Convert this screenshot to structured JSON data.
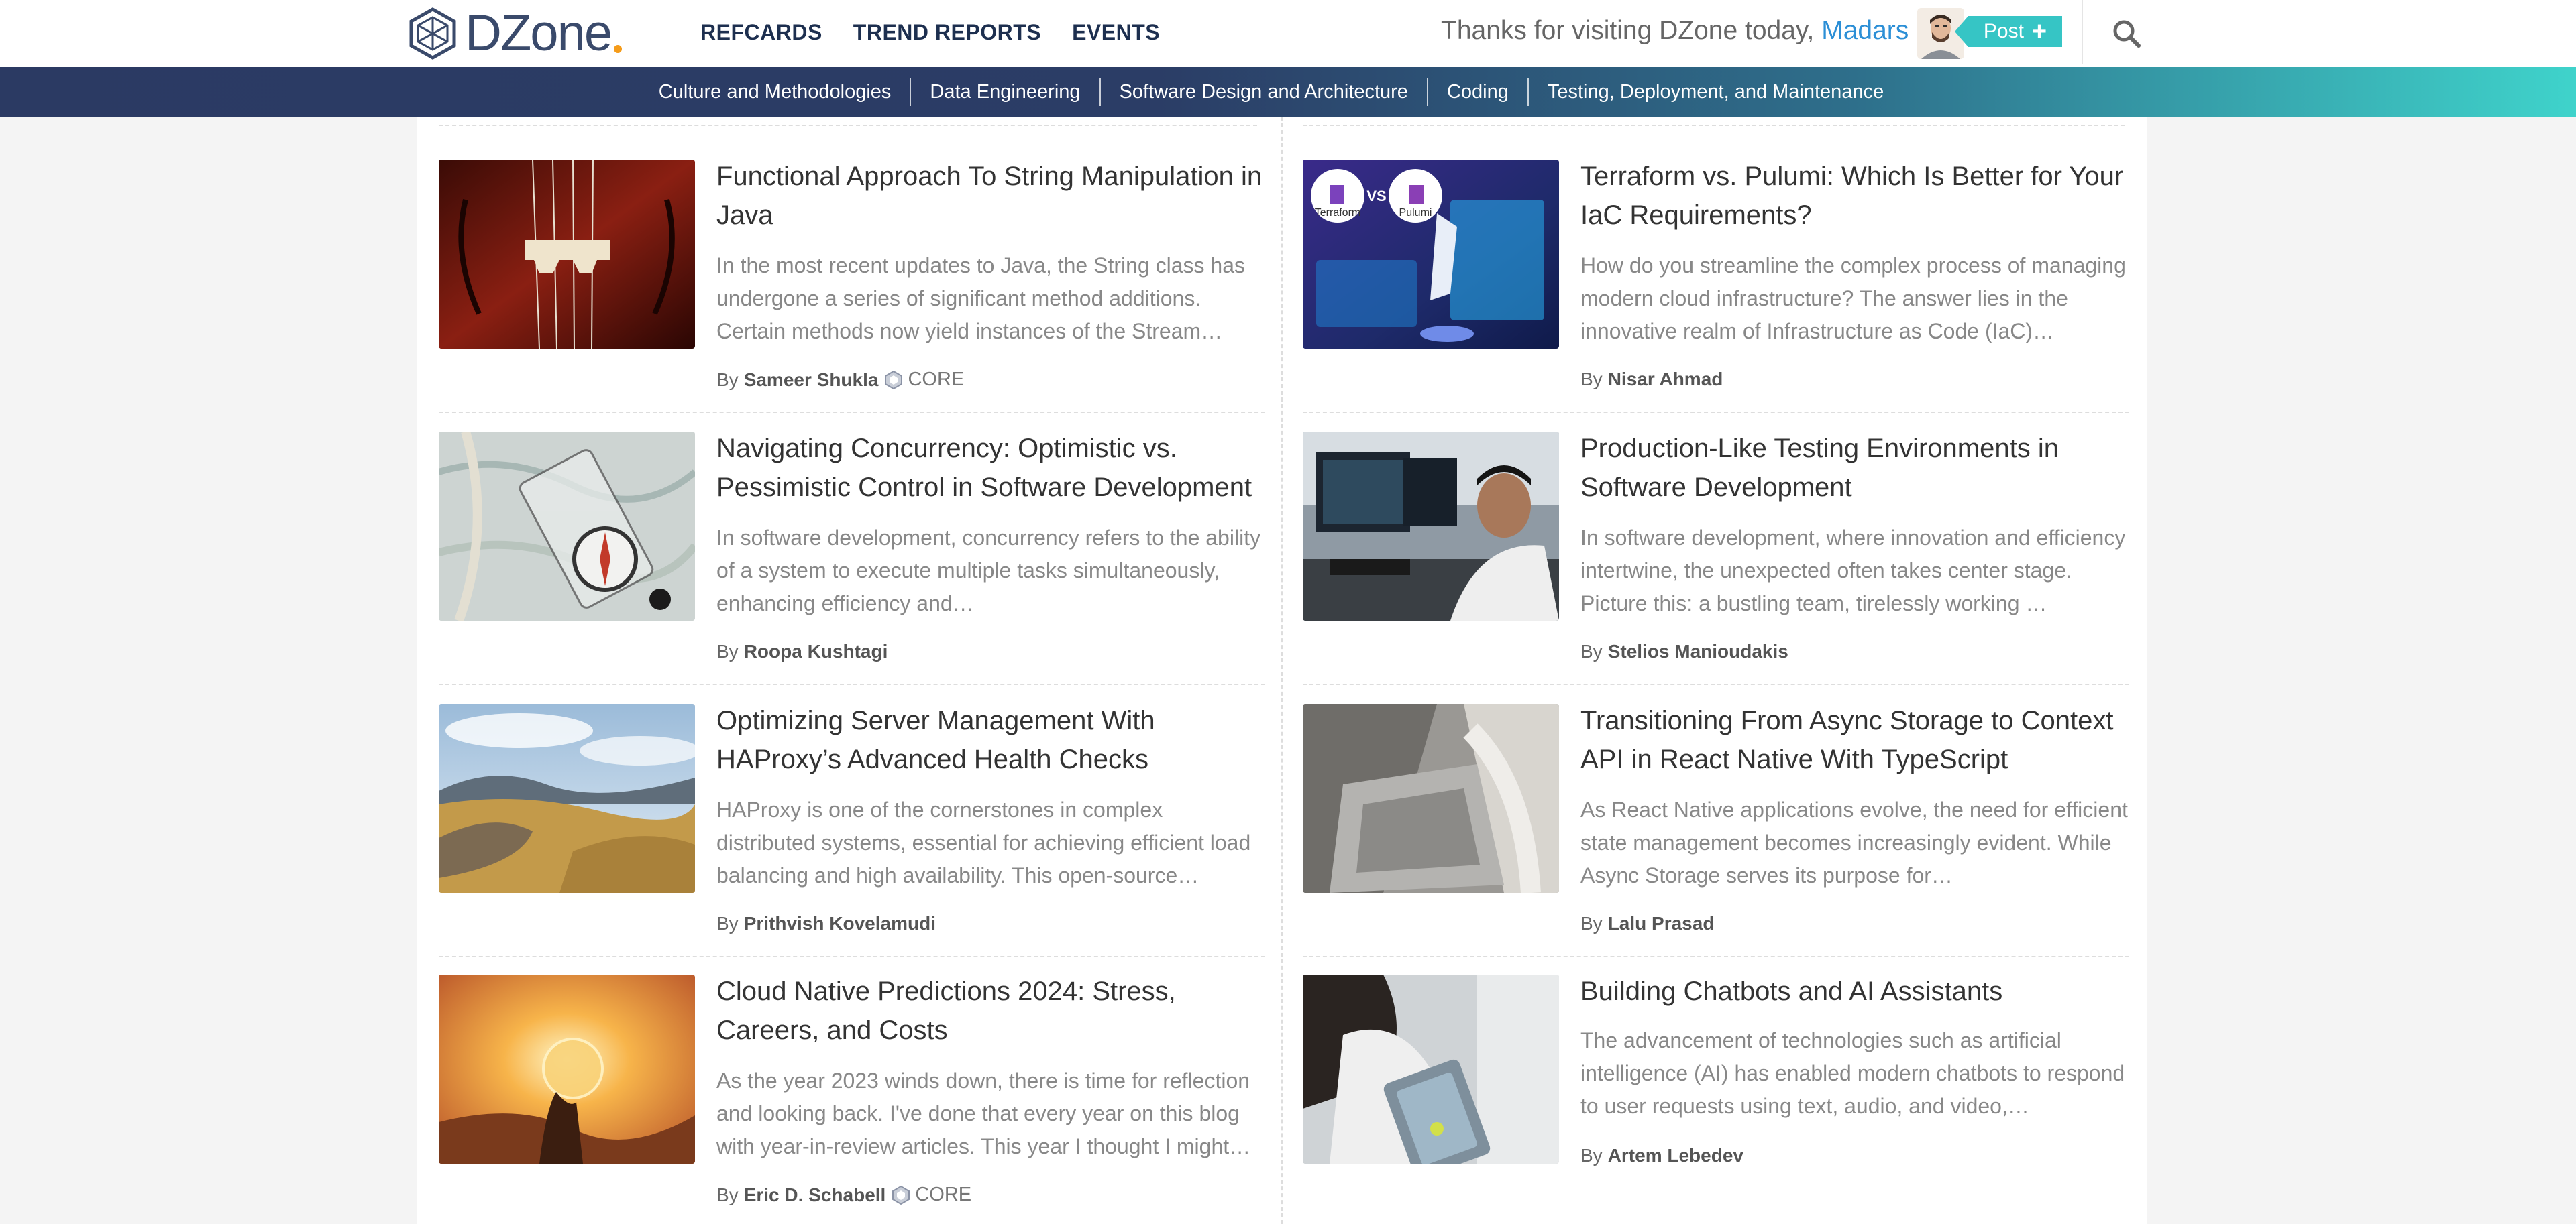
{
  "header": {
    "logo_text": "DZone",
    "nav": [
      "REFCARDS",
      "TREND REPORTS",
      "EVENTS"
    ],
    "greeting_prefix": "Thanks for visiting DZone today,",
    "username": "Madars",
    "post_label": "Post",
    "post_icon": "+",
    "search_icon": "search-icon"
  },
  "categories": [
    "Culture and Methodologies",
    "Data Engineering",
    "Software Design and Architecture",
    "Coding",
    "Testing, Deployment, and Maintenance"
  ],
  "articles": [
    {
      "title": "Functional Approach To String Manipulation in Java",
      "description": "In the most recent updates to Java, the String class has undergone a series of significant method additions. Certain methods now yield instances of the Stream…",
      "by": "By",
      "author": "Sameer Shukla",
      "badge": "CORE"
    },
    {
      "title": "Terraform vs. Pulumi: Which Is Better for Your IaC Requirements?",
      "description": "How do you streamline the complex process of managing modern cloud infrastructure? The answer lies in the innovative realm of Infrastructure as Code (IaC)…",
      "by": "By",
      "author": "Nisar Ahmad",
      "thumb_labels": [
        "Terraform",
        "VS",
        "Pulumi"
      ]
    },
    {
      "title": "Navigating Concurrency: Optimistic vs. Pessimistic Control in Software Development",
      "description": "In software development, concurrency refers to the ability of a system to execute multiple tasks simultaneously, enhancing efficiency and…",
      "by": "By",
      "author": "Roopa Kushtagi"
    },
    {
      "title": "Production-Like Testing Environments in Software Development",
      "description": "In software development, where innovation and efficiency intertwine, the unexpected often takes center stage. Picture this: a bustling team, tirelessly working …",
      "by": "By",
      "author": "Stelios Manioudakis"
    },
    {
      "title": "Optimizing Server Management With HAProxy’s Advanced Health Checks",
      "description": "HAProxy is one of the cornerstones in complex distributed systems, essential for achieving efficient load balancing and high availability. This open-source…",
      "by": "By",
      "author": "Prithvish Kovelamudi"
    },
    {
      "title": "Transitioning From Async Storage to Context API in React Native With TypeScript",
      "description": "As React Native applications evolve, the need for efficient state management becomes increasingly evident. While Async Storage serves its purpose for…",
      "by": "By",
      "author": "Lalu Prasad"
    },
    {
      "title": "Cloud Native Predictions 2024: Stress, Careers, and Costs",
      "description": "As the year 2023 winds down, there is time for reflection and looking back. I've done that every year on this blog with year-in-review articles. This year I thought I might…",
      "by": "By",
      "author": "Eric D. Schabell",
      "badge": "CORE"
    },
    {
      "title": "Building Chatbots and AI Assistants",
      "description": "The advancement of technologies such as artificial intelligence (AI) has enabled modern chatbots to respond to user requests using text, audio, and video,…",
      "by": "By",
      "author": "Artem Lebedev"
    }
  ],
  "colors": {
    "brand_navy": "#2b3a63",
    "accent_teal": "#36c5c5",
    "link_blue": "#2c8fd6"
  }
}
